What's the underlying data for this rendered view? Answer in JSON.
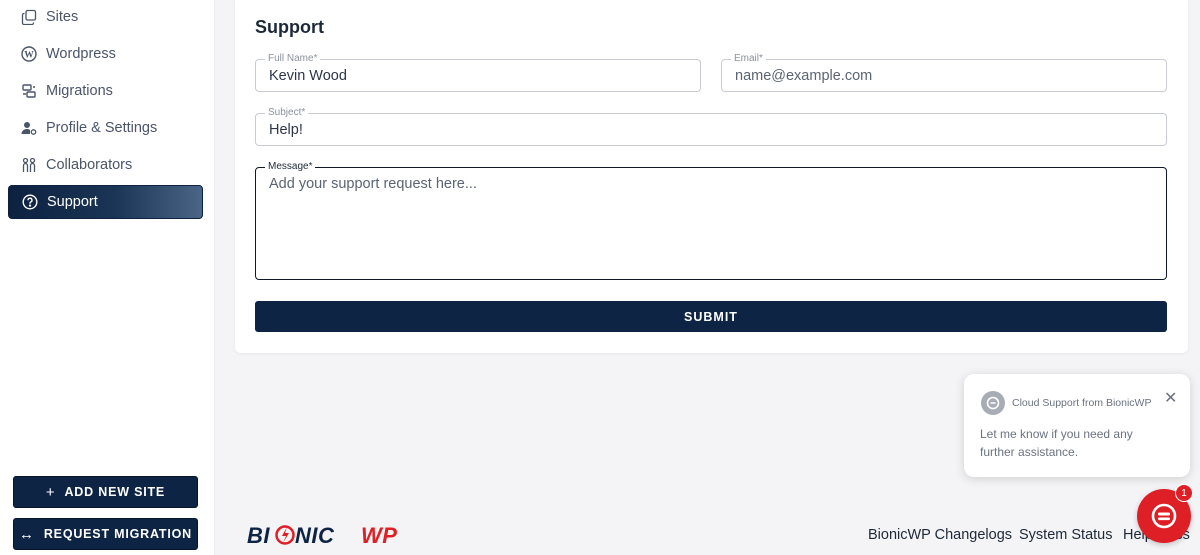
{
  "sidebar": {
    "items": [
      {
        "label": "Sites",
        "icon": "sites-icon"
      },
      {
        "label": "Wordpress",
        "icon": "wordpress-icon"
      },
      {
        "label": "Migrations",
        "icon": "migrations-icon"
      },
      {
        "label": "Profile & Settings",
        "icon": "profile-settings-icon"
      },
      {
        "label": "Collaborators",
        "icon": "collaborators-icon"
      },
      {
        "label": "Support",
        "icon": "help-circle-icon",
        "active": true
      }
    ],
    "add_site_label": "ADD NEW SITE",
    "request_migration_label": "REQUEST MIGRATION"
  },
  "support": {
    "title": "Support",
    "full_name": {
      "label": "Full Name*",
      "value": "Kevin Wood"
    },
    "email": {
      "label": "Email*",
      "placeholder": "name@example.com"
    },
    "subject": {
      "label": "Subject*",
      "value": "Help!"
    },
    "message": {
      "label": "Message*",
      "placeholder": "Add your support request here..."
    },
    "submit_label": "SUBMIT"
  },
  "footer": {
    "logo_text": "BIONICWP",
    "links": [
      "BionicWP Changelogs",
      "System Status",
      "Help Docs"
    ]
  },
  "chat": {
    "from": "Cloud Support from BionicWP",
    "message": "Let me know if you need any further assistance.",
    "badge_count": "1"
  },
  "colors": {
    "primary": "#0e2444",
    "accent_red": "#df1f26"
  }
}
